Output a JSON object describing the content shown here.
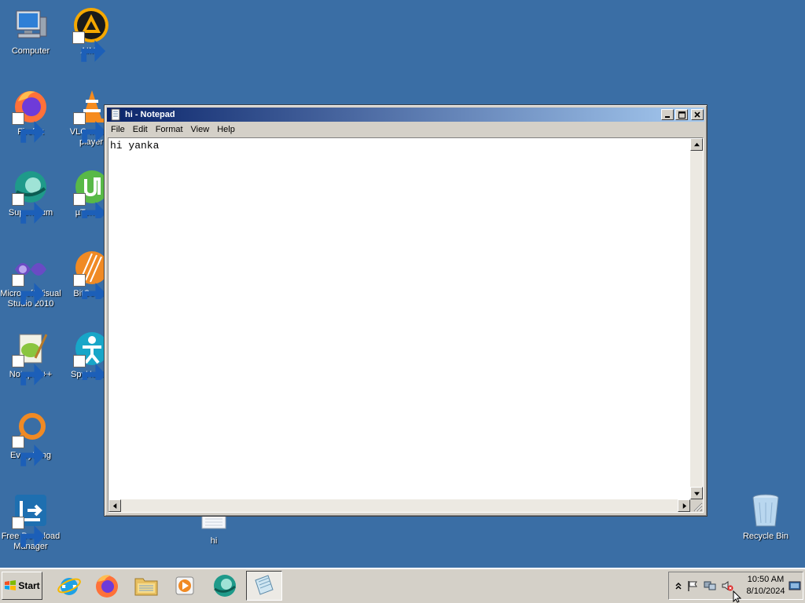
{
  "desktop": {
    "icons": [
      {
        "label": "Computer"
      },
      {
        "label": "AIMP"
      },
      {
        "label": "Firefox"
      },
      {
        "label": "VLC media player"
      },
      {
        "label": "Supermium"
      },
      {
        "label": "µTorrent"
      },
      {
        "label": "Microsoft Visual Studio 2010"
      },
      {
        "label": "BitComet"
      },
      {
        "label": "Notepad++"
      },
      {
        "label": "SpyHunter"
      },
      {
        "label": "Everything"
      },
      {
        "label": "Free Download Manager"
      },
      {
        "label": "hi"
      },
      {
        "label": "Recycle Bin"
      }
    ]
  },
  "notepad": {
    "title": "hi - Notepad",
    "menu": [
      "File",
      "Edit",
      "Format",
      "View",
      "Help"
    ],
    "content": "hi yanka"
  },
  "taskbar": {
    "start_label": "Start",
    "apps": [
      "internet-explorer",
      "firefox",
      "file-explorer",
      "media-player",
      "supermium",
      "notepad"
    ],
    "clock": {
      "time": "10:50 AM",
      "date": "8/10/2024"
    }
  },
  "colors": {
    "desktop": "#3a6ea5",
    "title_active_start": "#0a246a",
    "title_active_end": "#a6caf0"
  }
}
